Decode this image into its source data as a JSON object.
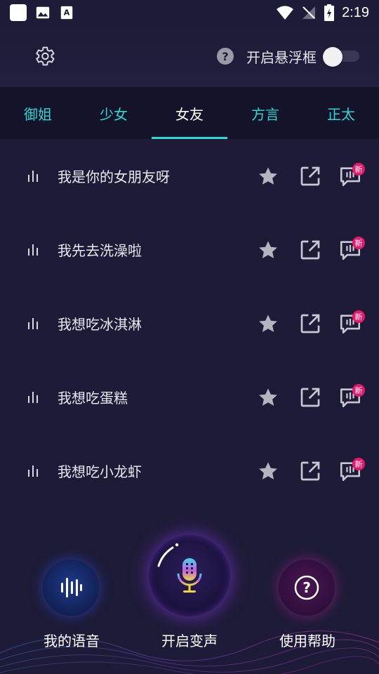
{
  "status_bar": {
    "time": "2:19"
  },
  "header": {
    "float_label": "开启悬浮框",
    "help_glyph": "?"
  },
  "tabs": [
    {
      "label": "御姐",
      "active": false
    },
    {
      "label": "少女",
      "active": false
    },
    {
      "label": "女友",
      "active": true
    },
    {
      "label": "方言",
      "active": false
    },
    {
      "label": "正太",
      "active": false
    }
  ],
  "list": [
    {
      "label": "我是你的女朋友呀",
      "badge": "新"
    },
    {
      "label": "我先去洗澡啦",
      "badge": "新"
    },
    {
      "label": "我想吃冰淇淋",
      "badge": "新"
    },
    {
      "label": "我想吃蛋糕",
      "badge": "新"
    },
    {
      "label": "我想吃小龙虾",
      "badge": "新"
    }
  ],
  "bottom": {
    "my_voice_label": "我的语音",
    "start_label": "开启变声",
    "help_label": "使用帮助",
    "help_glyph": "?"
  },
  "colors": {
    "background": "#1e1b38",
    "tab_bar": "#15132a",
    "accent": "#2fd8d6",
    "badge": "#e8186c"
  },
  "icons": [
    "gear-icon",
    "help-icon",
    "bars-icon",
    "star-icon",
    "share-icon",
    "voice-chat-icon",
    "soundwave-icon",
    "microphone-icon"
  ]
}
